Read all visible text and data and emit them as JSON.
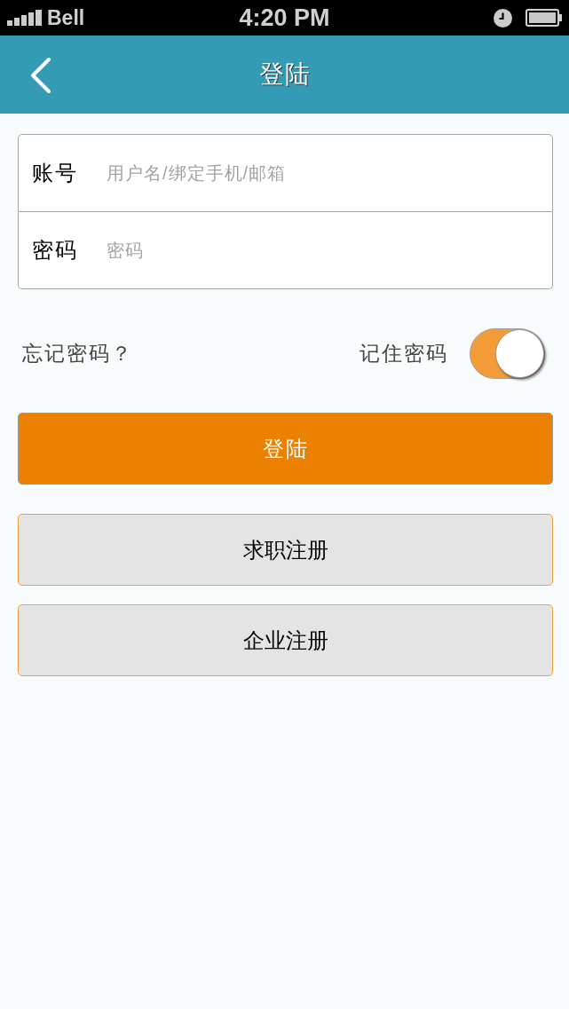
{
  "status_bar": {
    "carrier": "Bell",
    "time": "4:20 PM"
  },
  "nav_bar": {
    "title": "登陆"
  },
  "form": {
    "fields": [
      {
        "label": "账号",
        "placeholder": "用户名/绑定手机/邮箱"
      },
      {
        "label": "密码",
        "placeholder": "密码"
      }
    ]
  },
  "options": {
    "forgot_link": "忘记密码？",
    "remember": {
      "label": "记住密码",
      "on": true
    }
  },
  "buttons": [
    {
      "label": "登陆",
      "kind": "primary"
    },
    {
      "label": "求职注册",
      "kind": "secondary"
    },
    {
      "label": "企业注册",
      "kind": "secondary"
    }
  ]
}
